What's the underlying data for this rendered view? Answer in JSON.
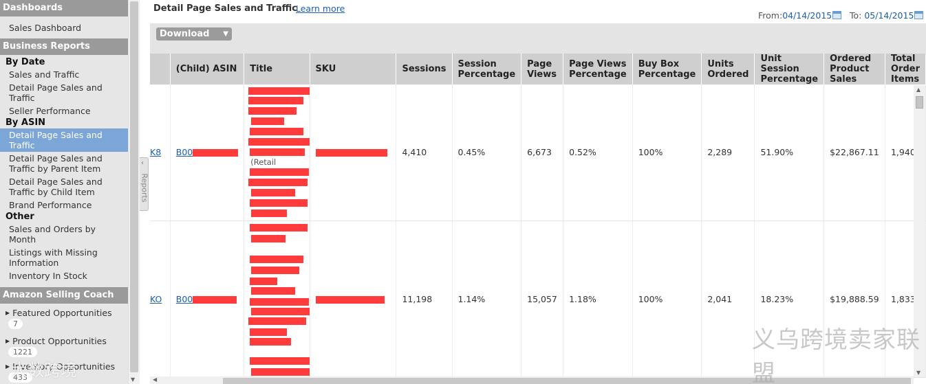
{
  "sidebar": {
    "dashboards_header": "Dashboards",
    "sales_dashboard": "Sales Dashboard",
    "business_reports_header": "Business Reports",
    "by_date": "By Date",
    "sales_and_traffic": "Sales and Traffic",
    "detail_page_sales_traffic": "Detail Page Sales and Traffic",
    "seller_performance": "Seller Performance",
    "by_asin": "By ASIN",
    "asin_detail_page": "Detail Page Sales and Traffic",
    "asin_by_parent": "Detail Page Sales and Traffic by Parent Item",
    "asin_by_child": "Detail Page Sales and Traffic by Child Item",
    "brand_performance": "Brand Performance",
    "other": "Other",
    "sales_orders_month": "Sales and Orders by Month",
    "listings_missing": "Listings with Missing Information",
    "inventory_in_stock": "Inventory In Stock",
    "coach_header": "Amazon Selling Coach",
    "coach_items": [
      {
        "label": "Featured Opportunities",
        "count": "7"
      },
      {
        "label": "Product Opportunities",
        "count": "1221"
      },
      {
        "label": "Inventory Opportunities",
        "count": "433"
      }
    ]
  },
  "reports_tab": "Reports",
  "header": {
    "title": "Detail Page Sales and Traffic",
    "learn_more": "Learn more",
    "from_label": "From:",
    "from_date": "04/14/2015",
    "to_label": "To:",
    "to_date": "05/14/2015"
  },
  "toolbar": {
    "download": "Download"
  },
  "table": {
    "columns": [
      "(Child) ASIN",
      "Title",
      "SKU",
      "Sessions",
      "Session Percentage",
      "Page Views",
      "Page Views Percentage",
      "Buy Box Percentage",
      "Units Ordered",
      "Unit Session Percentage",
      "Ordered Product Sales",
      "Total Order Items"
    ],
    "rows": [
      {
        "parent": "K8",
        "asin": "B00",
        "title": "(Retail",
        "sessions": "4,410",
        "session_pct": "0.45%",
        "page_views": "6,673",
        "pv_pct": "0.52%",
        "buybox": "100%",
        "units": "2,289",
        "unit_session": "51.90%",
        "sales": "$22,867.11",
        "items": "1,940"
      },
      {
        "parent": "KO",
        "asin": "B00",
        "title": "",
        "sessions": "11,198",
        "session_pct": "1.14%",
        "page_views": "15,057",
        "pv_pct": "1.18%",
        "buybox": "100%",
        "units": "2,041",
        "unit_session": "18.23%",
        "sales": "$19,888.59",
        "items": "1,833"
      }
    ]
  },
  "watermarks": {
    "right": "义乌跨境卖家联盟",
    "left": "大数跨境"
  },
  "colors": {
    "header_gray": "#9a9a9a",
    "active_blue": "#7da6d8",
    "link_blue": "#1a5fb4",
    "redaction_red": "#ff3b3b"
  }
}
